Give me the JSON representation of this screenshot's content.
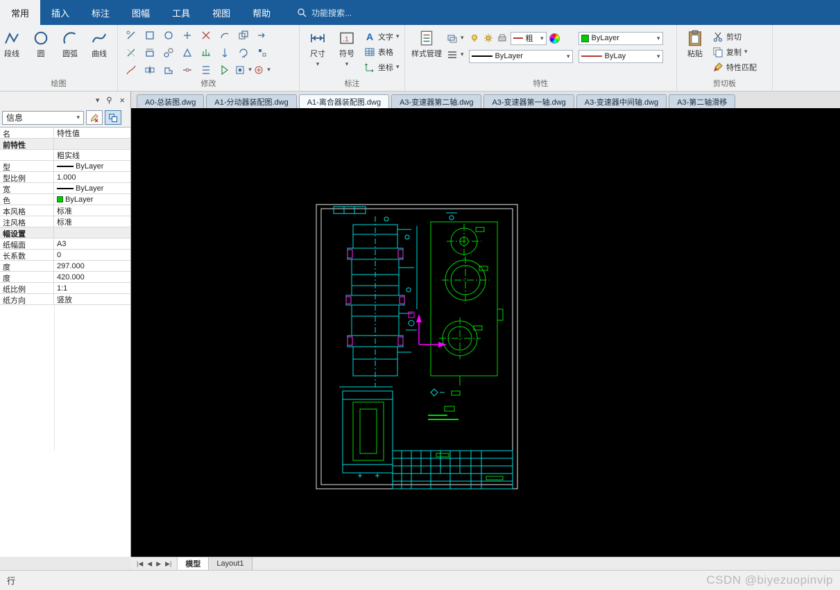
{
  "icons": {
    "chevron": "▾",
    "close": "×"
  },
  "menubar": {
    "tabs": [
      "常用",
      "插入",
      "标注",
      "图幅",
      "工具",
      "视图",
      "帮助"
    ],
    "search": "功能搜索..."
  },
  "ribbon": {
    "draw": {
      "label": "绘图",
      "tools": [
        "段线",
        "圆",
        "圆弧",
        "曲线"
      ]
    },
    "modify": {
      "label": "修改"
    },
    "dim": {
      "label": "标注",
      "size": "尺寸",
      "symbol": "符号",
      "text": "文字",
      "table": "表格",
      "coord": "坐标"
    },
    "props": {
      "label": "特性",
      "style_mgr": "样式管理",
      "width_combo": "粗",
      "layer_combo": "ByLayer",
      "linetype_combo": "ByLayer",
      "color_combo": "ByLay"
    },
    "clip": {
      "label": "剪切板",
      "paste": "粘贴",
      "cut": "剪切",
      "copy": "复制",
      "match": "特性匹配"
    }
  },
  "doc_tabs": {
    "items": [
      "A0-总装图.dwg",
      "A1-分动器装配图.dwg",
      "A1-离合器装配图.dwg",
      "A3-变速器第二轴.dwg",
      "A3-变速器第一轴.dwg",
      "A3-变速器中间轴.dwg",
      "A3-第二轴滑移"
    ]
  },
  "panel": {
    "combo": "信息",
    "header": {
      "name": "名",
      "value": "特性值"
    },
    "rows": [
      {
        "label": "前特性",
        "value": ""
      },
      {
        "label": "",
        "value": "粗实线"
      },
      {
        "label": "型",
        "value": "ByLayer"
      },
      {
        "label": "型比例",
        "value": "1.000"
      },
      {
        "label": "宽",
        "value": "ByLayer"
      },
      {
        "label": "色",
        "value": "ByLayer"
      },
      {
        "label": "本风格",
        "value": "标准"
      },
      {
        "label": "注风格",
        "value": "标准"
      },
      {
        "label": "幅设置",
        "value": ""
      },
      {
        "label": "纸幅面",
        "value": "A3"
      },
      {
        "label": "长系数",
        "value": "0"
      },
      {
        "label": "度",
        "value": "297.000"
      },
      {
        "label": "度",
        "value": "420.000"
      },
      {
        "label": "纸比例",
        "value": "1:1"
      },
      {
        "label": "纸方向",
        "value": "竖放"
      }
    ]
  },
  "model_bar": {
    "nav": [
      "|◀",
      "◀",
      "▶",
      "▶|"
    ],
    "tabs": [
      "模型",
      "Layout1"
    ]
  },
  "status": {
    "left": "行",
    "watermark": "CSDN @biyezuopinvip"
  },
  "colors": {
    "menubar_blue": "#1a5c99",
    "cad_cyan": "#00dddd",
    "cad_green": "#00d800",
    "cad_magenta": "#ff00ff",
    "bylayer_green": "#00cc00"
  }
}
